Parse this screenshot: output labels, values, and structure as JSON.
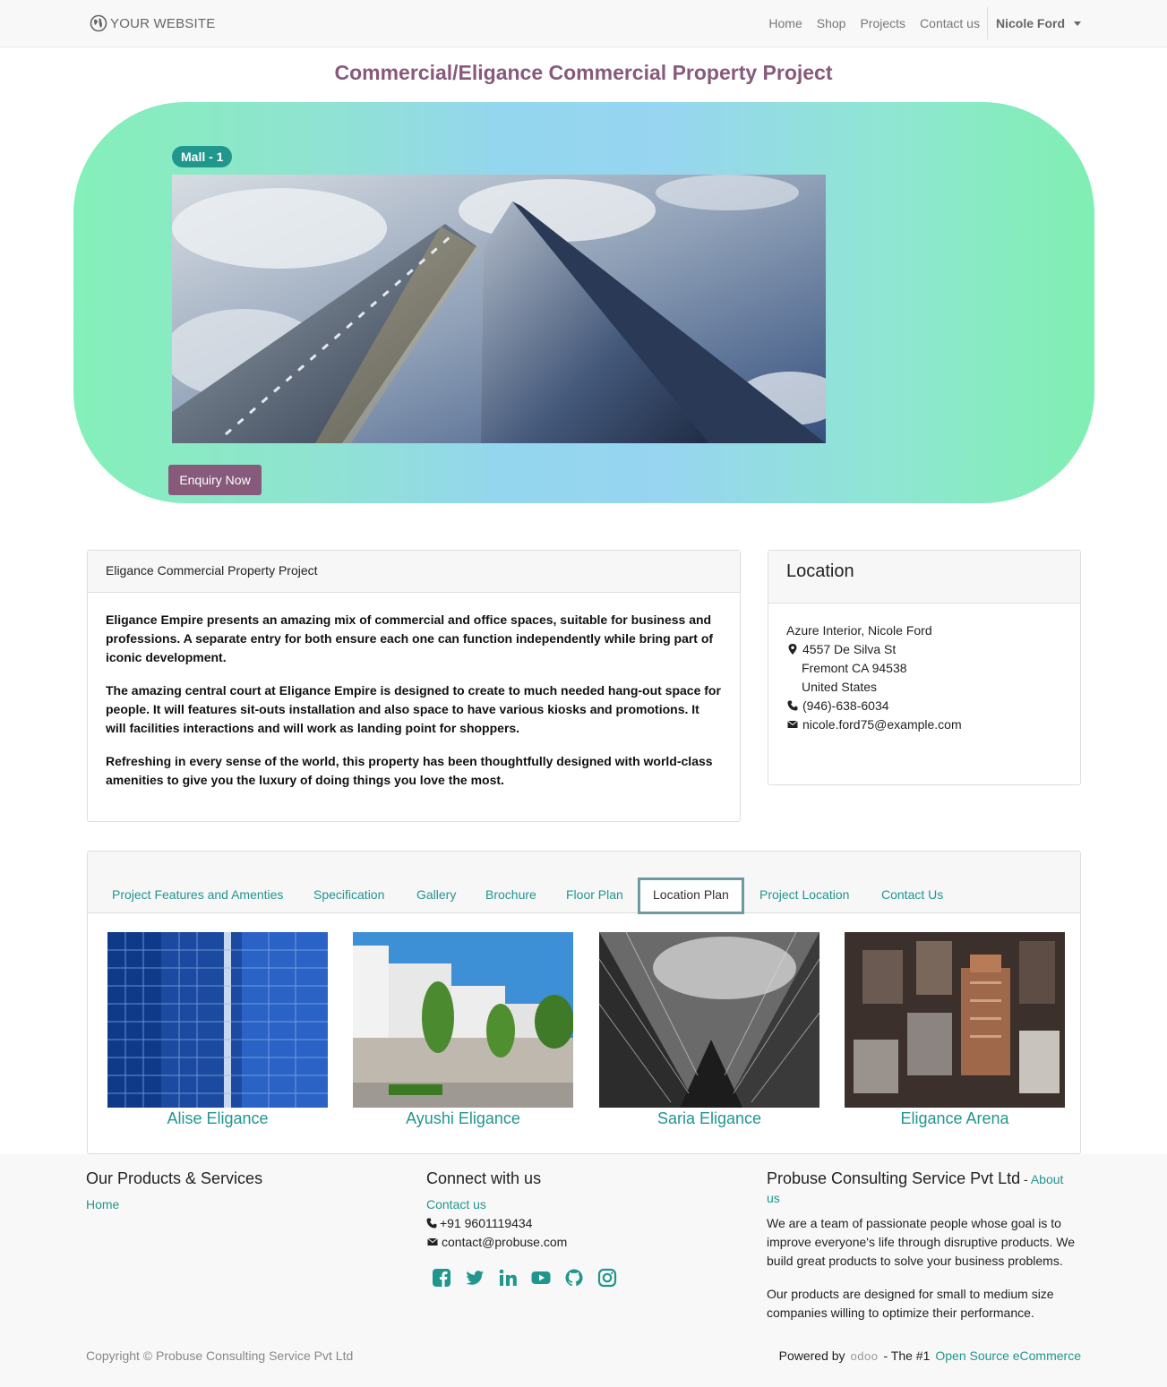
{
  "navbar": {
    "brand": "YOUR WEBSITE",
    "links": [
      "Home",
      "Shop",
      "Projects",
      "Contact us"
    ],
    "user": "Nicole Ford"
  },
  "page_title": "Commercial/Eligance Commercial Property Project",
  "hero": {
    "badge": "Mall - 1",
    "image": "skyscrapers-image",
    "enquiry_button": "Enquiry Now"
  },
  "description": {
    "header": "Eligance Commercial Property Project",
    "paragraphs": [
      "Eligance Empire presents an amazing mix of commercial and office spaces, suitable for business and professions. A separate entry for both ensure each one can function independently while bring part of iconic development.",
      "The amazing central court at Eligance Empire is designed to create to much needed hang-out space for people. It will features sit-outs installation and also space to have various kiosks and promotions. It will facilities interactions and will work as landing point for shoppers.",
      "Refreshing in every sense of the world, this property has been thoughtfully designed with world-class amenities to give you the luxury of doing things you love the most."
    ]
  },
  "location": {
    "title": "Location",
    "name": "Azure Interior, Nicole Ford",
    "street": "4557 De Silva St",
    "city": "Fremont CA 94538",
    "country": "United States",
    "phone": "(946)-638-6034",
    "email": "nicole.ford75@example.com"
  },
  "tabs": {
    "items": [
      "Project Features and Amenties",
      "Specification",
      "Gallery",
      "Brochure",
      "Floor Plan",
      "Location Plan",
      "Project Location",
      "Contact Us"
    ],
    "active": "Location Plan"
  },
  "projects": [
    {
      "name": "Alise Eligance"
    },
    {
      "name": "Ayushi Eligance"
    },
    {
      "name": "Saria Eligance"
    },
    {
      "name": "Eligance Arena"
    }
  ],
  "footer": {
    "products_title": "Our Products & Services",
    "products_link": "Home",
    "connect_title": "Connect with us",
    "connect_link": "Contact us",
    "phone": "+91 9601119434",
    "email": "contact@probuse.com",
    "company_title": "Probuse Consulting Service Pvt Ltd",
    "about_sep": " - ",
    "about_link": "About us",
    "about_p1": "We are a team of passionate people whose goal is to improve everyone's life through disruptive products. We build great products to solve your business problems.",
    "about_p2": "Our products are designed for small to medium size companies willing to optimize their performance.",
    "social_icons": [
      "facebook-icon",
      "twitter-icon",
      "linkedin-icon",
      "youtube-icon",
      "github-icon",
      "instagram-icon"
    ],
    "copyright": "Copyright © Probuse Consulting Service Pvt Ltd",
    "powered_by": "Powered by",
    "odoo": "odoo",
    "the_one": "- The #1",
    "open_source": "Open Source eCommerce"
  },
  "colors": {
    "accent": "#21968d",
    "brand": "#875a7b"
  }
}
